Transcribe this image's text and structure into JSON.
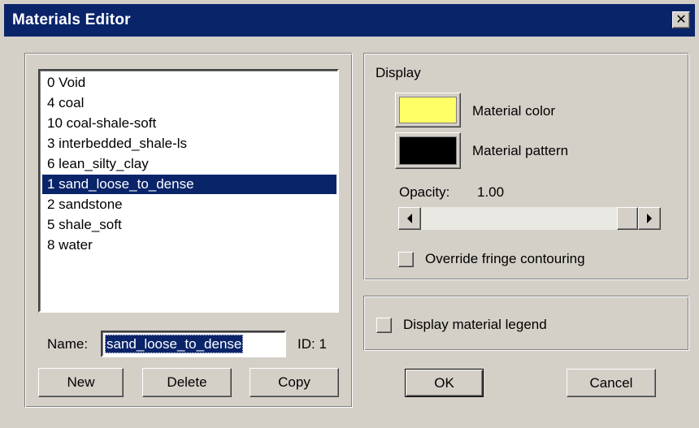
{
  "window": {
    "title": "Materials Editor",
    "close_glyph": "✕"
  },
  "materials": {
    "items": [
      {
        "label": "0 Void",
        "selected": false
      },
      {
        "label": "4 coal",
        "selected": false
      },
      {
        "label": "10 coal-shale-soft",
        "selected": false
      },
      {
        "label": "3 interbedded_shale-ls",
        "selected": false
      },
      {
        "label": "6 lean_silty_clay",
        "selected": false
      },
      {
        "label": "1 sand_loose_to_dense",
        "selected": true
      },
      {
        "label": "2 sandstone",
        "selected": false
      },
      {
        "label": "5 shale_soft",
        "selected": false
      },
      {
        "label": "8 water",
        "selected": false
      }
    ],
    "name_label": "Name:",
    "name_value": "sand_loose_to_dense",
    "id_label": "ID: 1",
    "buttons": {
      "new": "New",
      "delete": "Delete",
      "copy": "Copy"
    }
  },
  "display": {
    "group_label": "Display",
    "material_color_label": "Material color",
    "material_color": "#ffff66",
    "material_pattern_label": "Material pattern",
    "material_pattern_color": "#000000",
    "opacity_label": "Opacity:",
    "opacity_value": "1.00",
    "opacity_fraction": 1.0,
    "override_label": "Override fringe contouring",
    "override_checked": false
  },
  "legend": {
    "label": "Display material legend",
    "checked": false
  },
  "dialog_buttons": {
    "ok": "OK",
    "cancel": "Cancel"
  },
  "colors": {
    "titlebar": "#0a246a",
    "face": "#d4d0c8",
    "selection": "#0a246a"
  },
  "icons": {
    "close": "close-icon",
    "scroll_left": "arrow-left-icon",
    "scroll_right": "arrow-right-icon"
  }
}
